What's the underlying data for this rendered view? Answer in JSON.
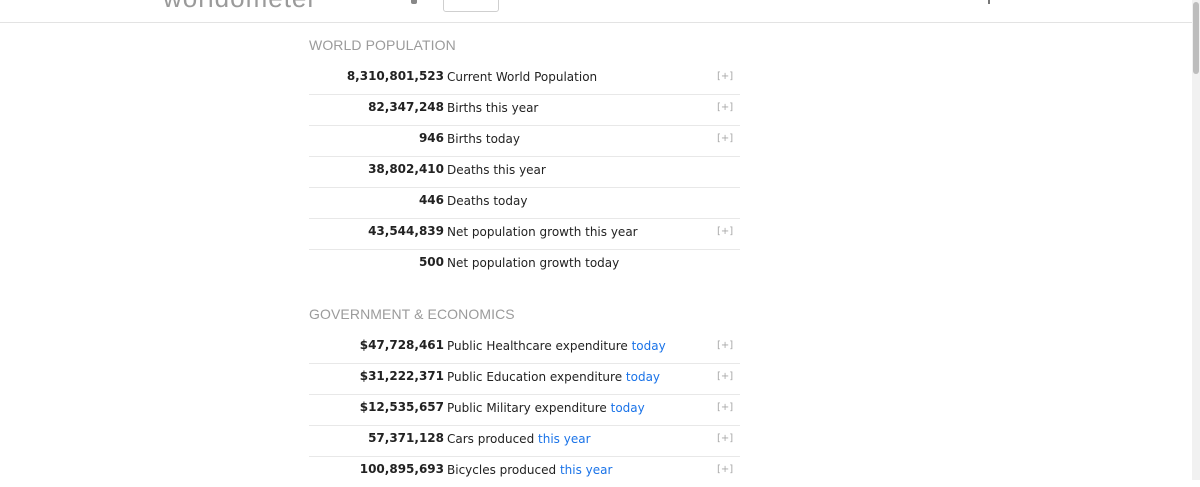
{
  "header": {
    "logo": "worldometer"
  },
  "sections": [
    {
      "title": "WORLD POPULATION",
      "rows": [
        {
          "value": "8,310,801,523",
          "label": "Current World Population",
          "link": "",
          "more": "[+]"
        },
        {
          "value": "82,347,248",
          "label": "Births this year",
          "link": "",
          "more": "[+]"
        },
        {
          "value": "946",
          "label": "Births today",
          "link": "",
          "more": "[+]"
        },
        {
          "value": "38,802,410",
          "label": "Deaths this year",
          "link": "",
          "more": ""
        },
        {
          "value": "446",
          "label": "Deaths today",
          "link": "",
          "more": ""
        },
        {
          "value": "43,544,839",
          "label": "Net population growth this year",
          "link": "",
          "more": "[+]"
        },
        {
          "value": "500",
          "label": "Net population growth today",
          "link": "",
          "more": ""
        }
      ]
    },
    {
      "title": "GOVERNMENT & ECONOMICS",
      "rows": [
        {
          "value": "$47,728,461",
          "label": "Public Healthcare expenditure",
          "link": "today",
          "more": "[+]"
        },
        {
          "value": "$31,222,371",
          "label": "Public Education expenditure",
          "link": "today",
          "more": "[+]"
        },
        {
          "value": "$12,535,657",
          "label": "Public Military expenditure",
          "link": "today",
          "more": "[+]"
        },
        {
          "value": "57,371,128",
          "label": "Cars produced",
          "link": "this year",
          "more": "[+]"
        },
        {
          "value": "100,895,693",
          "label": "Bicycles produced",
          "link": "this year",
          "more": "[+]"
        }
      ]
    }
  ]
}
